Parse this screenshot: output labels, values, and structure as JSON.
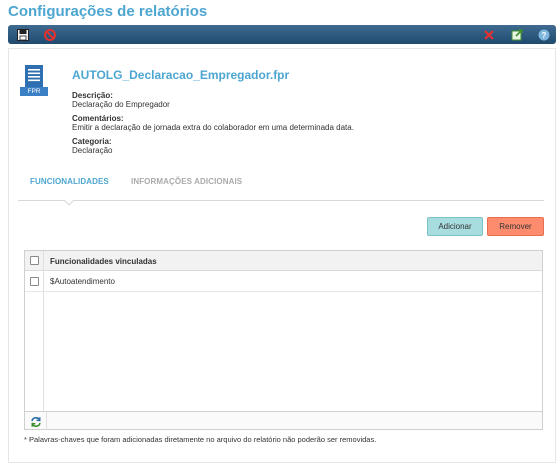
{
  "page": {
    "title": "Configurações de relatórios"
  },
  "toolbar": {
    "left_buttons": [
      {
        "name": "save-icon"
      },
      {
        "name": "cancel-icon"
      }
    ],
    "right_buttons": [
      {
        "name": "delete-icon"
      },
      {
        "name": "export-icon"
      },
      {
        "name": "help-icon"
      }
    ]
  },
  "report": {
    "file_icon_label": "FPR",
    "file_name": "AUTOLG_Declaracao_Empregador.fpr",
    "description_label": "Descrição:",
    "description_value": "Declaração do Empregador",
    "comments_label": "Comentários:",
    "comments_value": "Emitir a declaração de jornada extra do colaborador em uma determinada data.",
    "category_label": "Categoria:",
    "category_value": "Declaração"
  },
  "tabs": [
    {
      "label": "FUNCIONALIDADES",
      "active": true
    },
    {
      "label": "INFORMAÇÕES ADICIONAIS",
      "active": false
    }
  ],
  "actions": {
    "add_label": "Adicionar",
    "remove_label": "Remover"
  },
  "grid": {
    "header": "Funcionalidades vinculadas",
    "rows": [
      "$Autoatendimento"
    ]
  },
  "footnote": "* Palavras-chaves que foram adicionadas diretamente no arquivo do relatório não poderão ser removidas.",
  "colors": {
    "accent": "#4da6d1",
    "toolbar": "#2a5478",
    "add_button": "#a8dde0",
    "remove_button": "#fd8c6f"
  }
}
